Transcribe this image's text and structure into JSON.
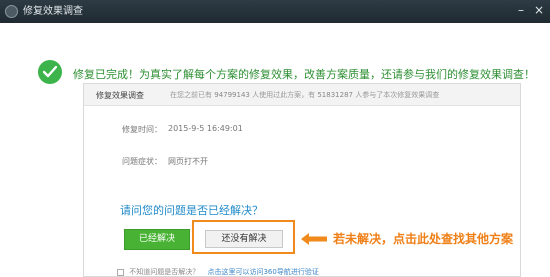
{
  "window": {
    "title": "修复效果调查"
  },
  "headline": "修复已完成！为真实了解每个方案的修复效果，改善方案质量，还请参与我们的修复效果调查！",
  "survey": {
    "tab_label": "修复效果调查",
    "stats_prefix": "在您之前已有",
    "stats_total": "94799143",
    "stats_middle": "人使用过此方案，有",
    "stats_count": "51831287",
    "stats_suffix": "人参与了本次修复效果调查",
    "time_label": "修复时间：",
    "time_value": "2015-9-5 16:49:01",
    "symptom_label": "问题症状：",
    "symptom_value": "网页打不开",
    "question": "请问您的问题是否已经解决？",
    "btn_yes": "已经解决",
    "btn_no": "还没有解决",
    "footer_checkbox": "不知道问题是否解决？",
    "footer_link": "点击这里可以访问360导航进行验证"
  },
  "annotation": "若未解决，点击此处查找其他方案",
  "colors": {
    "accent_green": "#3cb44b",
    "question_blue": "#1f8ac9",
    "annotation_orange": "#ef7f16"
  },
  "icons": {
    "app": "app-logo-icon",
    "success": "check-circle-icon",
    "arrow": "arrow-left-icon"
  }
}
